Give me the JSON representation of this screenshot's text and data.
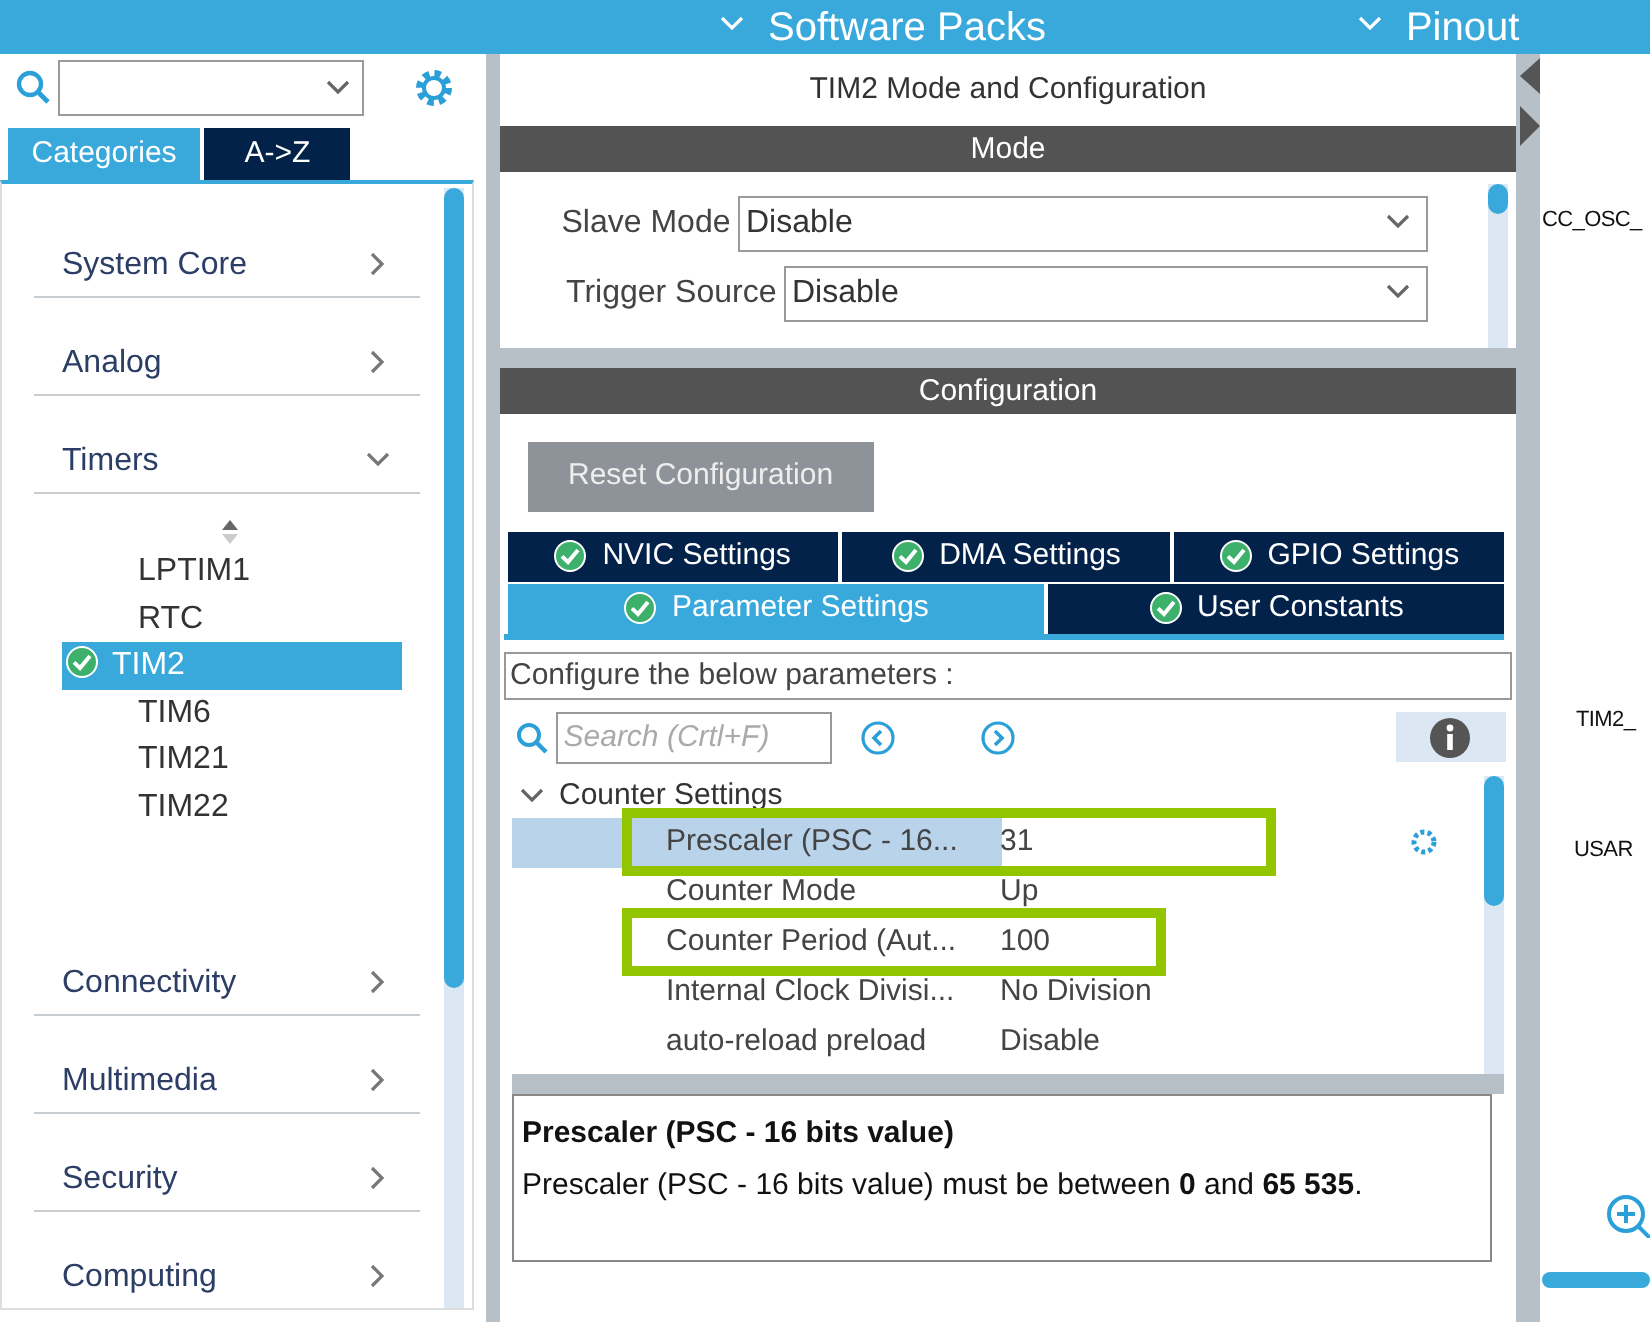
{
  "top_bar": {
    "menus": [
      {
        "label": "Software Packs"
      },
      {
        "label": "Pinout"
      }
    ]
  },
  "sidebar": {
    "tabs": [
      {
        "label": "Categories",
        "selected": true
      },
      {
        "label": "A->Z",
        "selected": false
      }
    ],
    "categories": [
      {
        "label": "System Core",
        "expanded": false
      },
      {
        "label": "Analog",
        "expanded": false
      },
      {
        "label": "Timers",
        "expanded": true,
        "children": [
          {
            "label": "LPTIM1",
            "selected": false,
            "checked": false
          },
          {
            "label": "RTC",
            "selected": false,
            "checked": false
          },
          {
            "label": "TIM2",
            "selected": true,
            "checked": true
          },
          {
            "label": "TIM6",
            "selected": false,
            "checked": false
          },
          {
            "label": "TIM21",
            "selected": false,
            "checked": false
          },
          {
            "label": "TIM22",
            "selected": false,
            "checked": false
          }
        ]
      },
      {
        "label": "Connectivity",
        "expanded": false
      },
      {
        "label": "Multimedia",
        "expanded": false
      },
      {
        "label": "Security",
        "expanded": false
      },
      {
        "label": "Computing",
        "expanded": false
      }
    ]
  },
  "mode_panel": {
    "title": "TIM2 Mode and Configuration",
    "header": "Mode",
    "fields": [
      {
        "label": "Slave Mode",
        "value": "Disable"
      },
      {
        "label": "Trigger Source",
        "value": "Disable"
      }
    ]
  },
  "configuration": {
    "header": "Configuration",
    "reset_button": "Reset Configuration",
    "tab_rows": [
      [
        {
          "label": "NVIC Settings",
          "selected": false
        },
        {
          "label": "DMA Settings",
          "selected": false
        },
        {
          "label": "GPIO Settings",
          "selected": false
        }
      ],
      [
        {
          "label": "Parameter Settings",
          "selected": true
        },
        {
          "label": "User Constants",
          "selected": false
        }
      ]
    ],
    "hint": "Configure the below parameters :",
    "search": {
      "placeholder": "Search (Crtl+F)"
    },
    "groups": [
      {
        "label": "Counter Settings",
        "expanded": true,
        "children": [
          {
            "label": "Prescaler (PSC - 16...",
            "value": "31",
            "selected": true,
            "highlighted": true
          },
          {
            "label": "Counter Mode",
            "value": "Up",
            "selected": false,
            "highlighted": false
          },
          {
            "label": "Counter Period (Aut...",
            "value": "100",
            "selected": false,
            "highlighted": true
          },
          {
            "label": "Internal Clock Divisi...",
            "value": "No Division",
            "selected": false,
            "highlighted": false
          },
          {
            "label": "auto-reload preload",
            "value": "Disable",
            "selected": false,
            "highlighted": false
          }
        ]
      }
    ],
    "description": {
      "title": "Prescaler (PSC - 16 bits value)",
      "text": "Prescaler (PSC - 16 bits value) must be between **0** and **65 535**."
    }
  },
  "pinout": {
    "labels": [
      "CC_OSC_",
      "TIM2_",
      "USAR"
    ]
  }
}
